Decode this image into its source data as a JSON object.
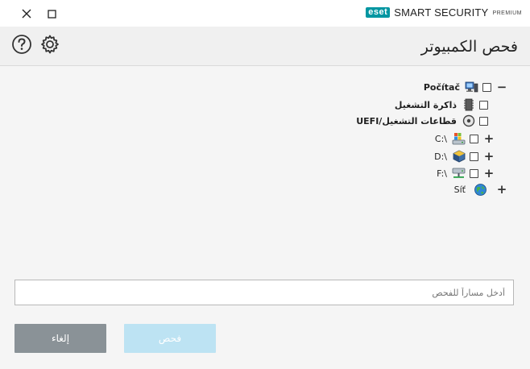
{
  "window": {
    "brand_logo": "eset",
    "brand_name": "SMART SECURITY",
    "brand_tier": "PREMIUM",
    "accent_color": "#0096a1"
  },
  "header": {
    "title": "فحص الكمبيوتر",
    "help_icon": "help-icon",
    "settings_icon": "gear-icon"
  },
  "tree": {
    "items": [
      {
        "label": "Počítač",
        "icon": "computer-icon",
        "expander": "−"
      },
      {
        "label": "ذاكرة التشغيل",
        "icon": "memory-chip-icon",
        "expander": ""
      },
      {
        "label": "UEFI/قطاعات التشغيل",
        "icon": "boot-disc-icon",
        "expander": ""
      },
      {
        "label": "C:\\",
        "icon": "system-drive-icon",
        "expander": "+"
      },
      {
        "label": "D:\\",
        "icon": "optical-drive-icon",
        "expander": "+"
      },
      {
        "label": "F:\\",
        "icon": "network-drive-icon",
        "expander": "+"
      },
      {
        "label": "Síť",
        "icon": "network-globe-icon",
        "expander": "+"
      }
    ]
  },
  "path": {
    "placeholder": "أدخل مساراً للفحص",
    "value": ""
  },
  "buttons": {
    "cancel": "إلغاء",
    "scan": "فحص",
    "cancel_color": "#8a9297",
    "scan_color": "#bde3f3"
  }
}
